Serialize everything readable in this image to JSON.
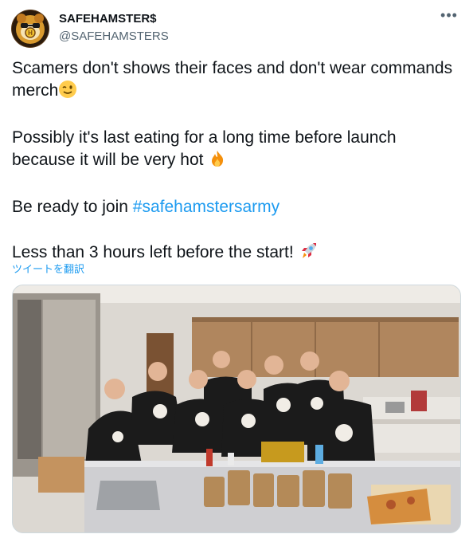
{
  "author": {
    "display_name": "SAFEHAMSTER$",
    "handle": "@SAFEHAMSTERS"
  },
  "menu": {
    "more_label": "•••"
  },
  "tweet": {
    "line1": "Scamers don't shows their faces and don't wear commands merch",
    "line2": "Possibly it's last eating for a long time before launch because it will be very hot",
    "line3_prefix": "Be ready to join ",
    "hashtag": "#safehamstersarmy",
    "line4": "Less than 3 hours left before the start!"
  },
  "translate_label": "ツイートを翻訳",
  "icons": {
    "avatar": "hamster-logo-icon",
    "more": "more-options-icon",
    "emoji1": "winking-face-emoji",
    "emoji2": "fire-emoji",
    "emoji3": "rocket-emoji"
  },
  "colors": {
    "link": "#1d9bf0",
    "text": "#0f1419",
    "secondary": "#536471",
    "border": "#cfd9de"
  }
}
